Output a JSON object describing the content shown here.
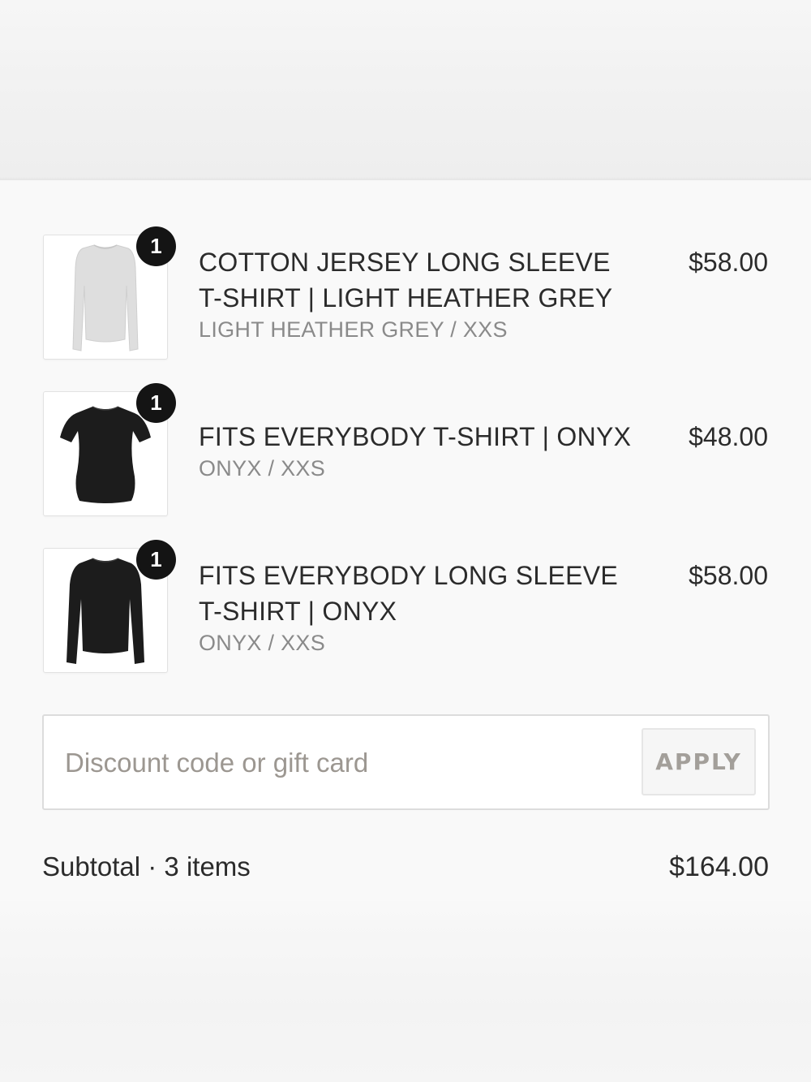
{
  "order_summary": {
    "items": [
      {
        "quantity": "1",
        "name_line1": "COTTON JERSEY LONG SLEEVE",
        "name_line2": "T-SHIRT | LIGHT HEATHER GREY",
        "variant": "LIGHT HEATHER GREY / XXS",
        "price": "$58.00",
        "image_color": "#dcdcdc",
        "image_icon": "long-sleeve-shirt-icon"
      },
      {
        "quantity": "1",
        "name_line1": "FITS EVERYBODY T-SHIRT | ONYX",
        "variant": "ONYX / XXS",
        "price": "$48.00",
        "image_color": "#1c1c1c",
        "image_icon": "short-sleeve-shirt-icon"
      },
      {
        "quantity": "1",
        "name_line1": "FITS EVERYBODY LONG SLEEVE",
        "name_line2": "T-SHIRT | ONYX",
        "variant": "ONYX / XXS",
        "price": "$58.00",
        "image_color": "#1c1c1c",
        "image_icon": "long-sleeve-shirt-icon"
      }
    ],
    "discount": {
      "placeholder": "Discount code or gift card",
      "value": "",
      "apply_label": "APPLY"
    },
    "subtotal": {
      "label": "Subtotal · 3 items",
      "value": "$164.00"
    }
  },
  "colors": {
    "badge": "#141414",
    "text": "#2b2b2b",
    "muted_text": "#8a8a8a",
    "apply_text": "#a39f9a"
  }
}
